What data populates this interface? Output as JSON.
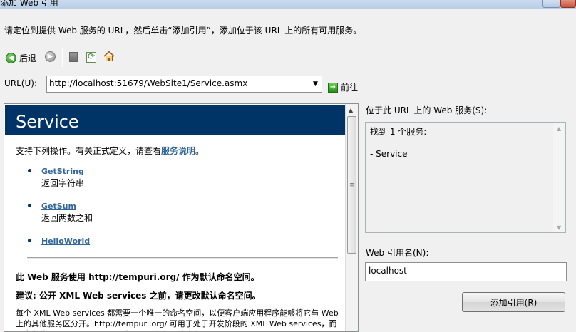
{
  "window": {
    "title": "添加 Web 引用"
  },
  "instruction": "请定位到提供 Web 服务的 URL，然后单击“添加引用”，添加位于该 URL 上的所有可用服务。",
  "toolbar": {
    "back_label": "后退",
    "icons": [
      "back-icon",
      "forward-icon",
      "stop-icon",
      "refresh-icon",
      "home-icon"
    ]
  },
  "url": {
    "label": "URL(U):",
    "value": "http://localhost:51679/WebSite1/Service.asmx",
    "go_label": "前往"
  },
  "browser": {
    "header": "Service",
    "intro_text": "支持下列操作。有关正式定义，请查看",
    "intro_link": "服务说明",
    "intro_end": "。",
    "operations": [
      {
        "name": "GetString",
        "desc": "返回字符串"
      },
      {
        "name": "GetSum",
        "desc": "返回两数之和"
      },
      {
        "name": "HelloWorld",
        "desc": ""
      }
    ],
    "namespace_line": "此 Web 服务使用 http://tempuri.org/ 作为默认命名空间。",
    "recommend_line": "建议: 公开 XML Web services 之前，请更改默认命名空间。",
    "body_text": "每个 XML Web services 都需要一个唯一的命名空间，以便客户端应用程序能够将它与 Web 上的其他服务区分开。http://tempuri.org/ 可用于处于开发阶段的 XML Web services，而已发布的 XML Web services 应使用更为永久的命名空间。"
  },
  "services": {
    "label": "位于此 URL 上的 Web 服务(S):",
    "found_text": "找到 1 个服务:",
    "items": [
      "- Service"
    ]
  },
  "reference": {
    "label": "Web 引用名(N):",
    "value": "localhost",
    "add_button": "添加引用(R)"
  },
  "colors": {
    "header_bg": "#003366",
    "link": "#336699"
  }
}
